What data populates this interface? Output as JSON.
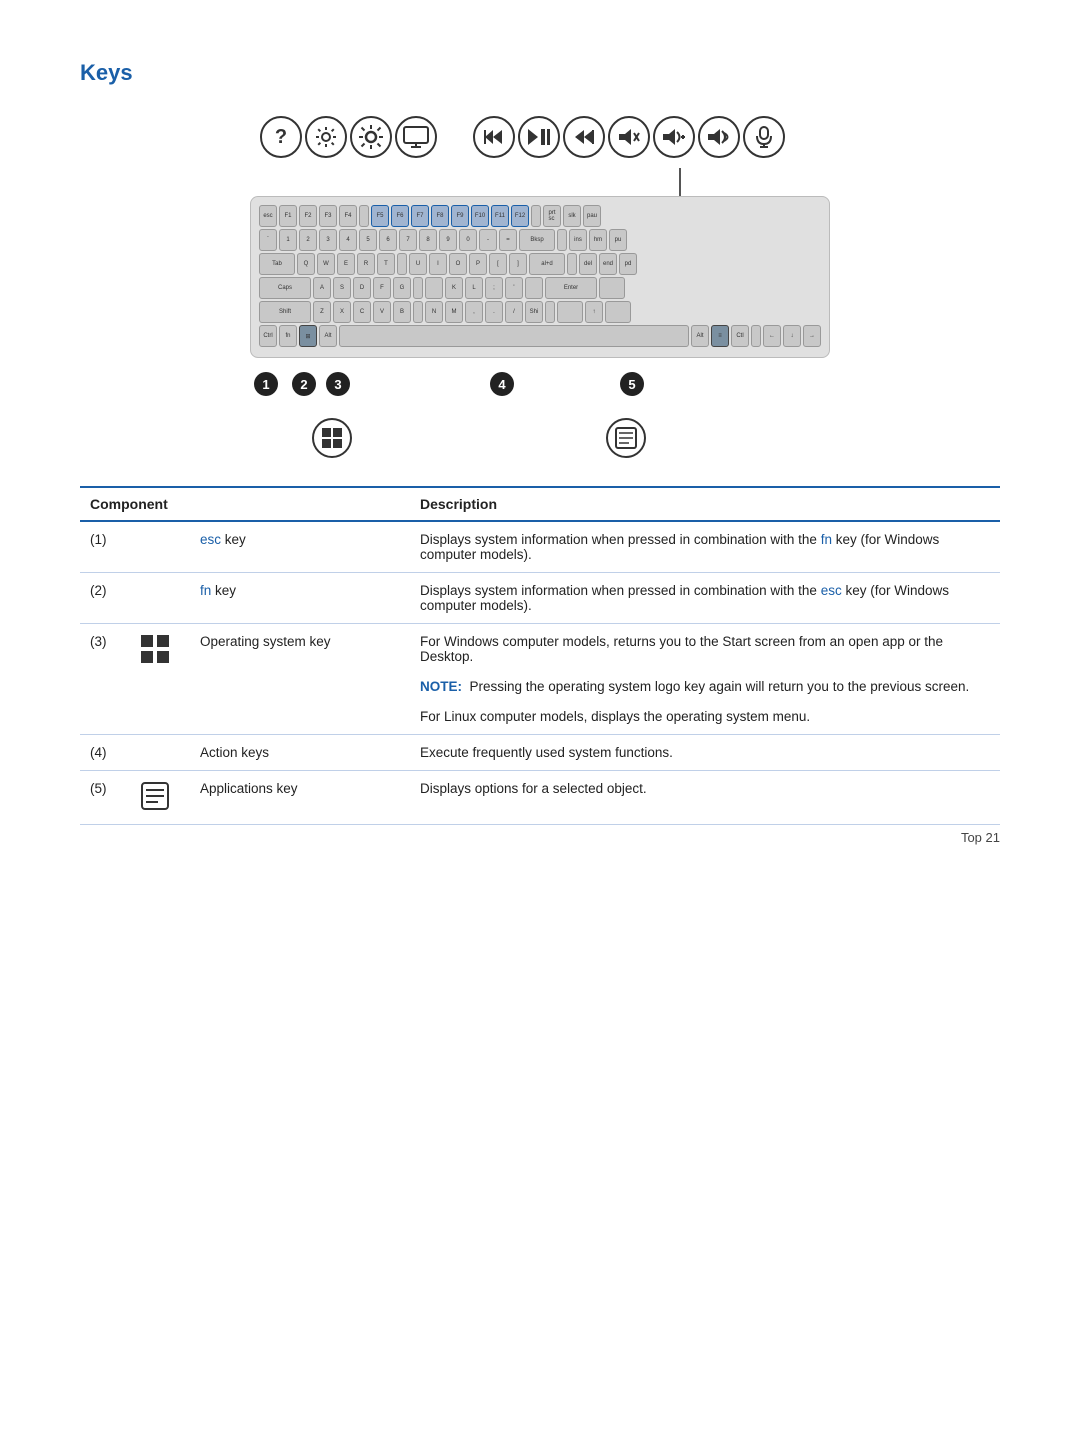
{
  "page": {
    "title": "Keys",
    "footer": "Top   21"
  },
  "action_icons": [
    {
      "id": "help",
      "symbol": "?"
    },
    {
      "id": "brightness-down",
      "symbol": "✳"
    },
    {
      "id": "brightness-up",
      "symbol": "✳"
    },
    {
      "id": "display",
      "symbol": "▭"
    },
    {
      "separator": true
    },
    {
      "id": "prev-track",
      "symbol": "◀◀"
    },
    {
      "id": "play-pause",
      "symbol": "▶❚"
    },
    {
      "id": "next-track",
      "symbol": "▶▶"
    },
    {
      "id": "mute",
      "symbol": "◀"
    },
    {
      "id": "volume-down",
      "symbol": "◀+"
    },
    {
      "id": "volume-up",
      "symbol": "◀"
    },
    {
      "id": "mute2",
      "symbol": "🔇"
    }
  ],
  "table": {
    "headers": [
      "Component",
      "Description"
    ],
    "rows": [
      {
        "num": "(1)",
        "icon": "",
        "component": "esc key",
        "component_color": "blue",
        "description": "Displays system information when pressed in combination with the fn key (for Windows computer models).",
        "fn_colored": "fn",
        "note": ""
      },
      {
        "num": "(2)",
        "icon": "",
        "component": "fn key",
        "component_color": "blue",
        "description": "Displays system information when pressed in combination with the esc key (for Windows computer models).",
        "esc_colored": "esc",
        "note": ""
      },
      {
        "num": "(3)",
        "icon": "windows",
        "component": "Operating system key",
        "component_color": "normal",
        "description": "For Windows computer models, returns you to the Start screen from an open app or the Desktop.",
        "note_label": "NOTE:",
        "note_text": "Pressing the operating system logo key again will return you to the previous screen.",
        "extra_text": "For Linux computer models, displays the operating system menu."
      },
      {
        "num": "(4)",
        "icon": "",
        "component": "Action keys",
        "component_color": "normal",
        "description": "Execute frequently used system functions.",
        "note": ""
      },
      {
        "num": "(5)",
        "icon": "applications",
        "component": "Applications key",
        "component_color": "normal",
        "description": "Displays options for a selected object.",
        "note": ""
      }
    ]
  }
}
